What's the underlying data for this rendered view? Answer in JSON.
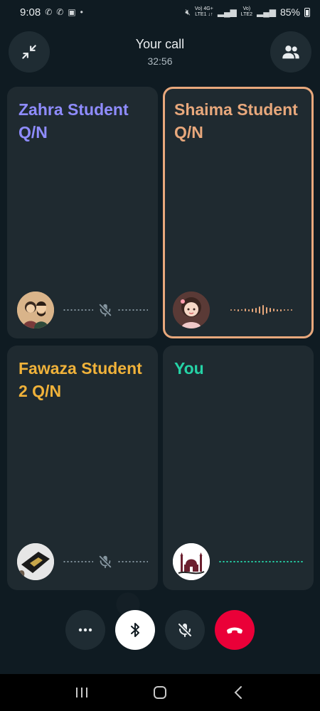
{
  "status_bar": {
    "time": "9:08",
    "network1": "Vo) 4G+\nLTE1",
    "network2": "Vo)\nLTE2",
    "battery": "85%"
  },
  "header": {
    "title": "Your call",
    "timer": "32:56"
  },
  "tiles": [
    {
      "name": "Zahra Student Q/N",
      "color": "#8f8cff",
      "state": "muted"
    },
    {
      "name": "Shaima Student Q/N",
      "color": "#e8a87c",
      "state": "speaking"
    },
    {
      "name": "Fawaza Student 2 Q/N",
      "color": "#f0b23a",
      "state": "muted"
    },
    {
      "name": "You",
      "color": "#25d3a6",
      "state": "silent"
    }
  ],
  "controls": [
    "more-options",
    "bluetooth",
    "mute",
    "end-call"
  ],
  "colors": {
    "speaking_border": "#e8a87c",
    "end_call": "#ea0038",
    "tile_bg": "#1f2a30"
  }
}
